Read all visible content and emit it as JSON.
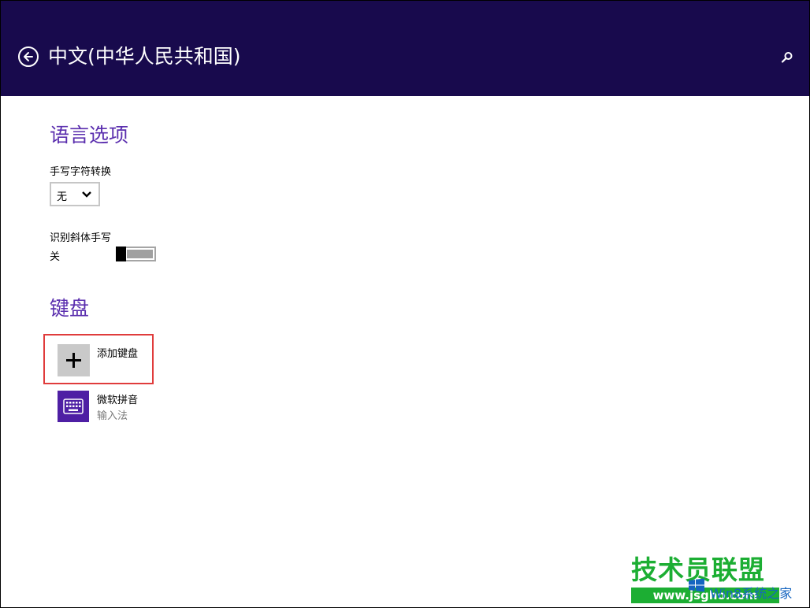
{
  "header": {
    "title": "中文(中华人民共和国)",
    "icons": {
      "back": "back-arrow-icon",
      "search": "search-icon"
    }
  },
  "language_options": {
    "section_title": "语言选项",
    "handwriting_conversion": {
      "label": "手写字符转换",
      "selected": "无"
    },
    "italic_handwriting": {
      "label": "识别斜体手写",
      "state": "关",
      "on": false
    }
  },
  "keyboard": {
    "section_title": "键盘",
    "add_label": "添加键盘",
    "items": [
      {
        "name": "微软拼音",
        "type": "输入法",
        "icon": "keyboard-icon"
      }
    ]
  },
  "watermark": {
    "text": "技术员联盟",
    "url": "www.jsgho.com",
    "sub": "Win8系统之家"
  },
  "colors": {
    "header_bg": "#180a4d",
    "accent": "#5a2eae",
    "keyboard_tile": "#4e1fa4",
    "highlight_border": "#e03c3c"
  }
}
